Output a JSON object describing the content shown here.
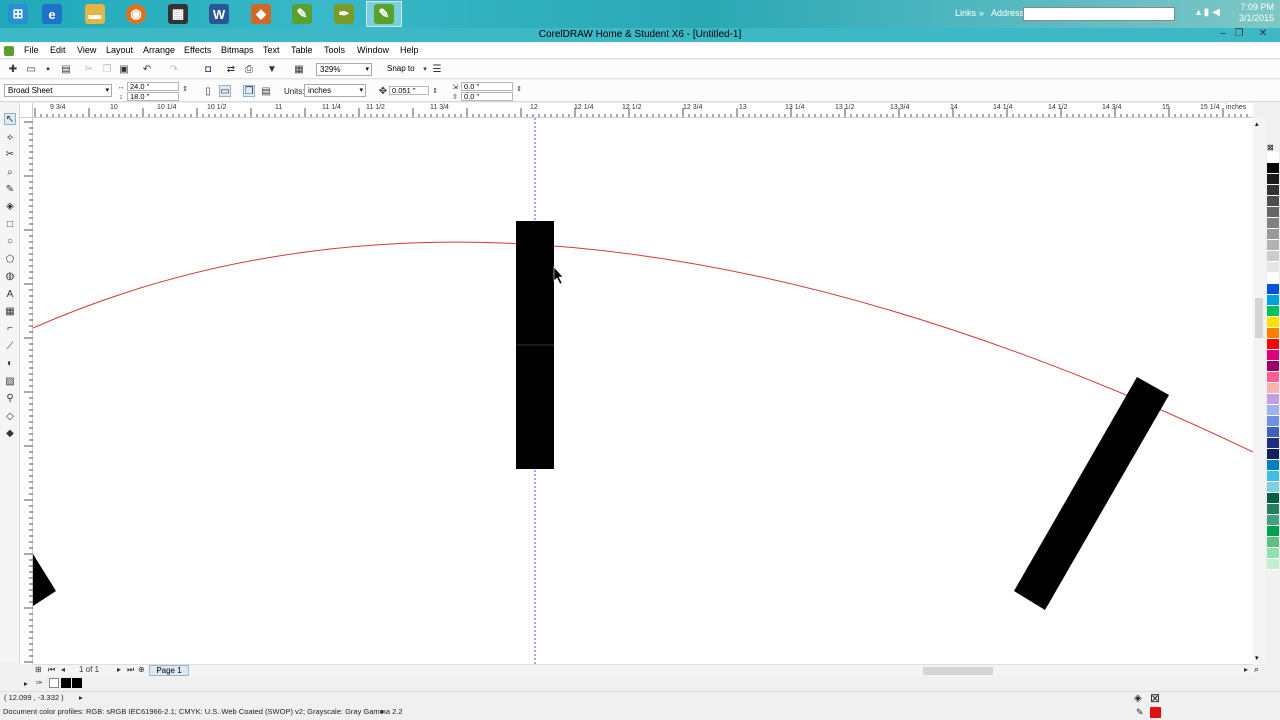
{
  "taskbar": {
    "apps": [
      {
        "name": "start-icon",
        "glyph": "⊞",
        "color": "#2a8fd0"
      },
      {
        "name": "ie-icon",
        "glyph": "e",
        "color": "#1e73c8"
      },
      {
        "name": "explorer-icon",
        "glyph": "▬",
        "color": "#e3b547"
      },
      {
        "name": "firefox-icon",
        "glyph": "◉",
        "color": "#e0711f"
      },
      {
        "name": "clapperboard-icon",
        "glyph": "▦",
        "color": "#333333"
      },
      {
        "name": "word-icon",
        "glyph": "W",
        "color": "#2b5797"
      },
      {
        "name": "corel-bitmap-icon",
        "glyph": "◆",
        "color": "#d0682a"
      },
      {
        "name": "corel-icon",
        "glyph": "✎",
        "color": "#5aa02c"
      },
      {
        "name": "corel-pen-icon",
        "glyph": "✒",
        "color": "#7a9a2a"
      },
      {
        "name": "coreldraw-active-icon",
        "glyph": "✎",
        "color": "#5aa02c"
      }
    ],
    "links_label": "Links",
    "address_label": "Address",
    "clock_time": "7:09 PM",
    "clock_date": "3/1/2015"
  },
  "titlebar": {
    "title": "CorelDRAW Home & Student X6 - [Untitled-1]",
    "minimize": "–",
    "restore": "❐",
    "close": "✕"
  },
  "menu": {
    "items": [
      "File",
      "Edit",
      "View",
      "Layout",
      "Arrange",
      "Effects",
      "Bitmaps",
      "Text",
      "Table",
      "Tools",
      "Window",
      "Help"
    ]
  },
  "standard_toolbar": {
    "zoom": "329%",
    "snap_to": "Snap to"
  },
  "property_bar": {
    "page_size": "Broad Sheet",
    "width": "24.0 \"",
    "height": "18.0 \"",
    "units_label": "Units:",
    "units": "inches",
    "nudge": "0.051 \"",
    "dup_x": "0.0 \"",
    "dup_y": "0.0 \""
  },
  "ruler": {
    "labels": [
      "9 3/4",
      "10",
      "10 1/4",
      "10 1/2",
      "11",
      "11 1/4",
      "11 1/2",
      "11 3/4",
      "12",
      "12 1/4",
      "12 1/2",
      "12 3/4",
      "13",
      "13 1/4",
      "13 1/2",
      "13 3/4",
      "14",
      "14 1/4",
      "14 1/2",
      "14 3/4",
      "15",
      "15 1/4",
      "inches"
    ]
  },
  "page_nav": {
    "page_count": "1 of 1",
    "page_tab": "Page 1"
  },
  "status": {
    "coordinates": "( 12.099 , -3.332 )",
    "color_profiles": "Document color profiles: RGB: sRGB IEC61966-2.1; CMYK: U.S. Web Coated (SWOP) v2; Grayscale: Gray Gamma 2.2"
  },
  "colors": {
    "arc": "#d23a32",
    "guide": "#3a5fd0",
    "shape_fill": "#000000",
    "fill_indicator": "#e01010"
  },
  "palette": [
    "#ffffff",
    "#000000",
    "#1a1a1a",
    "#333333",
    "#4d4d4d",
    "#666666",
    "#808080",
    "#999999",
    "#b3b3b3",
    "#cccccc",
    "#e6e6e6",
    "#ffffff",
    "#0050e0",
    "#00a0e0",
    "#00c060",
    "#ffe000",
    "#ff8000",
    "#ff0000",
    "#e0007a",
    "#a0006a",
    "#ff6090",
    "#ffb0b0",
    "#c0a0e0",
    "#a0b0f0",
    "#7090e0",
    "#4060c0",
    "#203080",
    "#102060",
    "#0080c0",
    "#40c0e0",
    "#80d0e0",
    "#006040",
    "#208060",
    "#40a080",
    "#00a050",
    "#60c080",
    "#90e0b0",
    "#c0f0d0"
  ]
}
